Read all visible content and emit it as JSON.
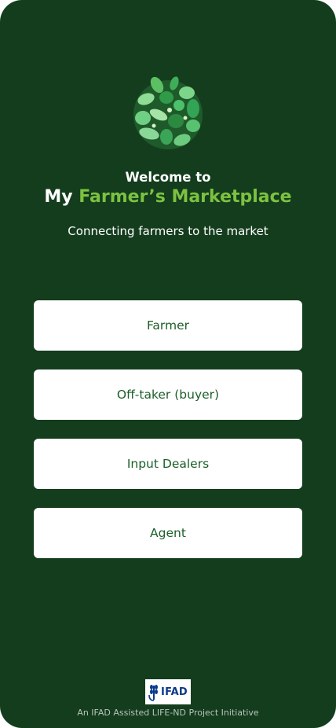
{
  "app": {
    "welcome": "Welcome to",
    "title_prefix": "My",
    "title_accent": "Farmer’s Marketplace",
    "tagline": "Connecting farmers to the market"
  },
  "roles": [
    {
      "label": "Farmer"
    },
    {
      "label": "Off-taker (buyer)"
    },
    {
      "label": "Input Dealers"
    },
    {
      "label": "Agent"
    }
  ],
  "footer": {
    "sponsor_logo_text": "IFAD",
    "credit": "An IFAD Assisted LIFE-ND Project Initiative"
  },
  "colors": {
    "background": "#143d1e",
    "accent": "#7cc241",
    "button_text": "#1b5e28",
    "button_bg": "#ffffff",
    "sponsor_blue": "#0b3a8a"
  },
  "icons": {
    "app_logo": "produce-circle-logo-icon",
    "sponsor_logo": "ifad-logo-icon"
  }
}
